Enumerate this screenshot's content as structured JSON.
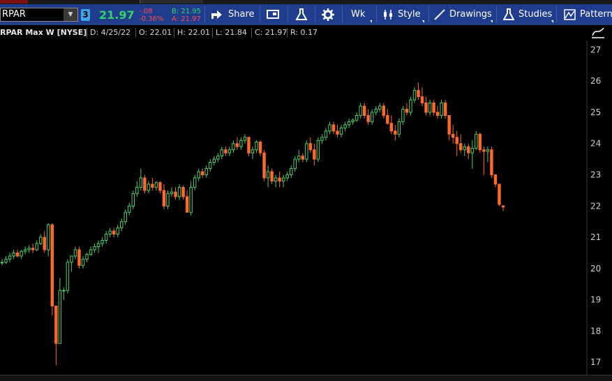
{
  "toolbar": {
    "symbol": "RPAR",
    "link_badge": "3",
    "last_price": "21.97",
    "change": "-.08",
    "change_pct": "-0.36%",
    "bid": "B: 21.95",
    "ask": "A: 21.97",
    "share_label": "Share",
    "aggregation_label": "Wk",
    "style_label": "Style",
    "drawings_label": "Drawings",
    "studies_label": "Studies",
    "patterns_label": "Patterns"
  },
  "info": {
    "title": "RPAR Max W [NYSE]",
    "date": "D: 4/25/22",
    "open": "O: 22.01",
    "high": "H: 22.01",
    "low": "L: 21.84",
    "close": "C: 21.97",
    "range": "R: 0.17"
  },
  "colors": {
    "up": "#4ecf6b",
    "down": "#ff6a2a",
    "toolbar": "#1f3d8c",
    "price_green": "#33d36b"
  },
  "chart_data": {
    "type": "candlestick",
    "title": "RPAR Max W [NYSE]",
    "yticks": [
      17,
      18,
      19,
      20,
      21,
      22,
      23,
      24,
      25,
      26,
      27
    ],
    "ylim": [
      16.6,
      27.3
    ],
    "grid": false,
    "candles": [
      [
        20.2,
        20.3,
        20.1,
        20.2
      ],
      [
        20.2,
        20.4,
        20.15,
        20.3
      ],
      [
        20.3,
        20.5,
        20.2,
        20.4
      ],
      [
        20.4,
        20.6,
        20.3,
        20.5
      ],
      [
        20.5,
        20.6,
        20.35,
        20.4
      ],
      [
        20.4,
        20.6,
        20.3,
        20.55
      ],
      [
        20.55,
        20.7,
        20.45,
        20.6
      ],
      [
        20.6,
        20.75,
        20.5,
        20.65
      ],
      [
        20.65,
        20.8,
        20.5,
        20.6
      ],
      [
        20.6,
        20.9,
        20.55,
        20.8
      ],
      [
        20.8,
        21.1,
        20.75,
        21.0
      ],
      [
        21.0,
        21.2,
        20.5,
        20.6
      ],
      [
        20.6,
        21.45,
        20.4,
        21.4
      ],
      [
        21.4,
        21.45,
        18.5,
        18.8
      ],
      [
        18.8,
        18.8,
        16.9,
        17.6
      ],
      [
        17.6,
        19.7,
        17.6,
        19.3
      ],
      [
        19.3,
        19.4,
        19.0,
        19.3
      ],
      [
        19.3,
        20.3,
        19.2,
        20.2
      ],
      [
        20.2,
        20.4,
        19.9,
        20.4
      ],
      [
        20.4,
        20.7,
        20.3,
        20.6
      ],
      [
        20.6,
        20.7,
        20.0,
        20.1
      ],
      [
        20.1,
        20.4,
        20.0,
        20.3
      ],
      [
        20.3,
        20.5,
        20.2,
        20.45
      ],
      [
        20.45,
        20.7,
        20.4,
        20.6
      ],
      [
        20.6,
        20.8,
        20.5,
        20.7
      ],
      [
        20.7,
        20.9,
        20.5,
        20.8
      ],
      [
        20.8,
        21.0,
        20.7,
        20.9
      ],
      [
        20.9,
        21.2,
        20.8,
        21.1
      ],
      [
        21.1,
        21.3,
        21.0,
        21.2
      ],
      [
        21.2,
        21.3,
        21.0,
        21.1
      ],
      [
        21.1,
        21.4,
        21.0,
        21.3
      ],
      [
        21.3,
        21.6,
        21.2,
        21.5
      ],
      [
        21.5,
        21.9,
        21.4,
        21.8
      ],
      [
        21.8,
        22.1,
        21.7,
        22.0
      ],
      [
        22.0,
        22.5,
        21.9,
        22.4
      ],
      [
        22.4,
        22.8,
        22.3,
        22.6
      ],
      [
        22.6,
        23.2,
        22.5,
        22.9
      ],
      [
        22.9,
        23.0,
        22.4,
        22.5
      ],
      [
        22.5,
        22.8,
        22.4,
        22.7
      ],
      [
        22.7,
        22.9,
        22.5,
        22.6
      ],
      [
        22.6,
        22.8,
        22.5,
        22.75
      ],
      [
        22.75,
        22.8,
        22.4,
        22.5
      ],
      [
        22.5,
        22.7,
        21.9,
        22.0
      ],
      [
        22.0,
        22.5,
        21.9,
        22.4
      ],
      [
        22.4,
        22.6,
        22.3,
        22.45
      ],
      [
        22.45,
        22.6,
        22.2,
        22.3
      ],
      [
        22.3,
        22.7,
        22.2,
        22.6
      ],
      [
        22.6,
        22.65,
        22.2,
        22.3
      ],
      [
        22.3,
        22.5,
        21.8,
        21.8
      ],
      [
        21.8,
        22.8,
        21.7,
        22.6
      ],
      [
        22.6,
        23.0,
        22.5,
        22.9
      ],
      [
        22.9,
        23.2,
        22.8,
        23.1
      ],
      [
        23.1,
        23.2,
        22.9,
        23.0
      ],
      [
        23.0,
        23.3,
        22.9,
        23.2
      ],
      [
        23.2,
        23.5,
        23.1,
        23.4
      ],
      [
        23.4,
        23.6,
        23.3,
        23.5
      ],
      [
        23.5,
        23.7,
        23.4,
        23.6
      ],
      [
        23.6,
        23.9,
        23.5,
        23.8
      ],
      [
        23.8,
        23.9,
        23.6,
        23.7
      ],
      [
        23.7,
        23.9,
        23.6,
        23.8
      ],
      [
        23.8,
        24.1,
        23.7,
        24.0
      ],
      [
        24.0,
        24.2,
        23.8,
        23.9
      ],
      [
        23.9,
        24.2,
        23.8,
        24.1
      ],
      [
        24.1,
        24.3,
        24.0,
        24.2
      ],
      [
        24.2,
        24.2,
        23.6,
        23.7
      ],
      [
        23.7,
        23.9,
        23.5,
        23.8
      ],
      [
        23.8,
        24.1,
        23.7,
        24.05
      ],
      [
        24.05,
        24.1,
        23.6,
        23.7
      ],
      [
        23.7,
        23.8,
        22.8,
        22.9
      ],
      [
        22.9,
        23.3,
        22.6,
        23.1
      ],
      [
        23.1,
        23.2,
        22.7,
        22.8
      ],
      [
        22.8,
        23.0,
        22.6,
        22.9
      ],
      [
        22.9,
        23.1,
        22.6,
        22.8
      ],
      [
        22.8,
        23.0,
        22.6,
        22.9
      ],
      [
        22.9,
        23.1,
        22.8,
        23.0
      ],
      [
        23.0,
        23.3,
        22.9,
        23.2
      ],
      [
        23.2,
        23.6,
        23.1,
        23.5
      ],
      [
        23.5,
        23.8,
        23.4,
        23.6
      ],
      [
        23.6,
        23.7,
        23.4,
        23.5
      ],
      [
        23.5,
        24.1,
        23.4,
        24.0
      ],
      [
        24.0,
        24.2,
        23.7,
        23.8
      ],
      [
        23.8,
        24.0,
        23.3,
        23.5
      ],
      [
        23.5,
        24.2,
        23.4,
        24.1
      ],
      [
        24.1,
        24.3,
        24.0,
        24.2
      ],
      [
        24.2,
        24.5,
        24.1,
        24.4
      ],
      [
        24.4,
        24.7,
        24.3,
        24.6
      ],
      [
        24.6,
        24.7,
        24.3,
        24.4
      ],
      [
        24.4,
        24.6,
        24.2,
        24.3
      ],
      [
        24.3,
        24.6,
        24.2,
        24.5
      ],
      [
        24.5,
        24.7,
        24.4,
        24.6
      ],
      [
        24.6,
        24.8,
        24.5,
        24.7
      ],
      [
        24.7,
        24.8,
        24.6,
        24.75
      ],
      [
        24.75,
        25.0,
        24.7,
        24.9
      ],
      [
        24.9,
        25.3,
        24.8,
        25.2
      ],
      [
        25.2,
        25.3,
        24.8,
        24.9
      ],
      [
        24.9,
        25.1,
        24.6,
        24.7
      ],
      [
        24.7,
        25.1,
        24.6,
        25.0
      ],
      [
        25.0,
        25.2,
        24.9,
        25.1
      ],
      [
        25.1,
        25.3,
        25.0,
        25.2
      ],
      [
        25.2,
        25.3,
        24.8,
        24.9
      ],
      [
        24.9,
        25.1,
        24.6,
        24.65
      ],
      [
        24.65,
        24.9,
        24.3,
        24.4
      ],
      [
        24.4,
        24.6,
        24.1,
        24.3
      ],
      [
        24.3,
        24.8,
        24.2,
        24.7
      ],
      [
        24.7,
        25.2,
        24.6,
        25.1
      ],
      [
        25.1,
        25.3,
        24.9,
        25.0
      ],
      [
        25.0,
        25.5,
        24.9,
        25.4
      ],
      [
        25.4,
        25.8,
        25.3,
        25.7
      ],
      [
        25.7,
        25.95,
        25.4,
        25.5
      ],
      [
        25.5,
        25.8,
        25.2,
        25.3
      ],
      [
        25.3,
        25.5,
        24.9,
        25.0
      ],
      [
        25.0,
        25.4,
        24.9,
        25.3
      ],
      [
        25.3,
        25.4,
        24.9,
        25.0
      ],
      [
        25.0,
        25.2,
        24.8,
        24.9
      ],
      [
        24.9,
        25.4,
        24.8,
        25.3
      ],
      [
        25.3,
        25.4,
        24.8,
        24.9
      ],
      [
        24.9,
        24.9,
        24.1,
        24.3
      ],
      [
        24.3,
        24.6,
        24.0,
        24.2
      ],
      [
        24.2,
        24.4,
        23.6,
        24.0
      ],
      [
        24.0,
        24.3,
        23.7,
        23.8
      ],
      [
        23.8,
        24.0,
        23.6,
        23.9
      ],
      [
        23.9,
        24.0,
        23.5,
        23.7
      ],
      [
        23.7,
        24.1,
        23.2,
        23.85
      ],
      [
        23.85,
        24.4,
        23.8,
        24.3
      ],
      [
        24.3,
        24.35,
        23.7,
        23.8
      ],
      [
        23.8,
        23.9,
        23.0,
        23.75
      ],
      [
        23.75,
        23.9,
        23.4,
        23.8
      ],
      [
        23.8,
        23.9,
        22.9,
        23.0
      ],
      [
        23.0,
        23.0,
        22.6,
        22.7
      ],
      [
        22.7,
        22.7,
        22.0,
        22.05
      ],
      [
        22.01,
        22.01,
        21.84,
        21.97
      ]
    ]
  }
}
